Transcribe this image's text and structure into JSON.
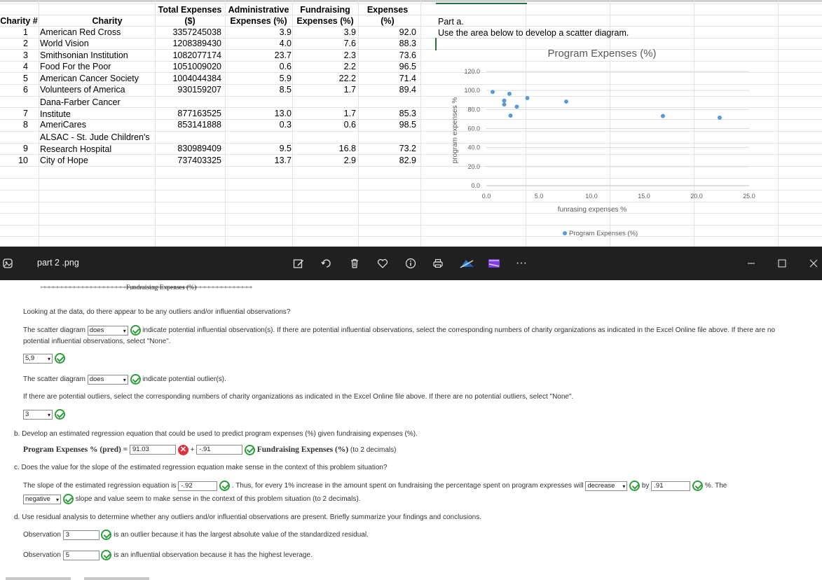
{
  "spreadsheet": {
    "headers": {
      "charity_num": "Charity #",
      "charity": "Charity",
      "total_l1": "Total Expenses",
      "total_l2": "($)",
      "admin_l1": "Administrative",
      "admin_l2": "Expenses (%)",
      "fund_l1": "Fundraising",
      "fund_l2": "Expenses (%)",
      "prog_l1": "Expenses",
      "prog_l2": "(%)"
    },
    "rows": [
      {
        "num": "1",
        "name": [
          "American Red Cross"
        ],
        "total": "3357245038",
        "admin": "3.9",
        "fund": "3.9",
        "prog": "92.0"
      },
      {
        "num": "2",
        "name": [
          "World Vision"
        ],
        "total": "1208389430",
        "admin": "4.0",
        "fund": "7.6",
        "prog": "88.3"
      },
      {
        "num": "3",
        "name": [
          "Smithsonian Institution"
        ],
        "total": "1082077174",
        "admin": "23.7",
        "fund": "2.3",
        "prog": "73.6"
      },
      {
        "num": "4",
        "name": [
          "Food For the Poor"
        ],
        "total": "1051009020",
        "admin": "0.6",
        "fund": "2.2",
        "prog": "96.5"
      },
      {
        "num": "5",
        "name": [
          "American Cancer Society"
        ],
        "total": "1004044384",
        "admin": "5.9",
        "fund": "22.2",
        "prog": "71.4"
      },
      {
        "num": "6",
        "name": [
          "Volunteers of America"
        ],
        "total": "930159207",
        "admin": "8.5",
        "fund": "1.7",
        "prog": "89.4"
      },
      {
        "num": "7",
        "name": [
          "Dana-Farber Cancer",
          "Institute"
        ],
        "total": "877163525",
        "admin": "13.0",
        "fund": "1.7",
        "prog": "85.3"
      },
      {
        "num": "8",
        "name": [
          "AmeriCares"
        ],
        "total": "853141888",
        "admin": "0.3",
        "fund": "0.6",
        "prog": "98.5"
      },
      {
        "num": "9",
        "name": [
          "ALSAC - St. Jude Children's",
          "Research Hospital"
        ],
        "total": "830989409",
        "admin": "9.5",
        "fund": "16.8",
        "prog": "73.2"
      },
      {
        "num": "10",
        "name": [
          "City of Hope"
        ],
        "total": "737403325",
        "admin": "13.7",
        "fund": "2.9",
        "prog": "82.9"
      }
    ],
    "part_a_label": "Part a.",
    "part_a_text": "Use the area below to develop a scatter diagram."
  },
  "chart_data": {
    "type": "scatter",
    "title": "Program Expenses (%)",
    "xlabel": "funrasing expenses %",
    "ylabel": "program expenses %",
    "xlim": [
      0,
      25
    ],
    "ylim": [
      0,
      120
    ],
    "x_ticks": [
      "0.0",
      "5.0",
      "10.0",
      "15.0",
      "20.0",
      "25.0"
    ],
    "y_ticks": [
      "0.0",
      "20.0",
      "40.0",
      "60.0",
      "80.0",
      "100.0",
      "120.0"
    ],
    "legend": "bottom",
    "grid": true,
    "series": [
      {
        "name": "Program Expenses (%)",
        "color": "#5b9bd5",
        "points": [
          [
            0.6,
            98.5
          ],
          [
            1.7,
            89.4
          ],
          [
            1.7,
            85.3
          ],
          [
            2.2,
            96.5
          ],
          [
            2.3,
            73.6
          ],
          [
            2.9,
            82.9
          ],
          [
            3.9,
            92.0
          ],
          [
            7.6,
            88.3
          ],
          [
            16.8,
            73.2
          ],
          [
            22.2,
            71.4
          ]
        ]
      }
    ]
  },
  "viewer": {
    "filename": "part 2 .png",
    "fragment_label": "Fundraising Expenses (%)"
  },
  "question": {
    "intro": "Looking at the data, do there appear to be any outliers and/or influential observations?",
    "infl_prefix": "The scatter diagram",
    "infl_select": "does",
    "infl_suffix": "indicate potential influential observation(s). If there are potential influential observations, select the corresponding numbers of charity organizations as indicated in the Excel Online file above. If there are no potential influential observations, select \"None\".",
    "infl_answer": "5,9",
    "out_prefix": "The scatter diagram",
    "out_select": "does",
    "out_suffix": "indicate potential outlier(s).",
    "out_instruction": "If there are potential outliers, select the corresponding numbers of charity organizations as indicated in the Excel Online file above. If there are no potential outliers, select \"None\".",
    "out_answer": "3",
    "b_text": "b. Develop an estimated regression equation that could be used to predict program expenses (%) given fundraising expenses (%).",
    "b_lhs": "Program Expenses % (pred) =",
    "b_intercept": "91.03",
    "b_plus": "+",
    "b_slope": "-.91",
    "b_rhs": "Fundraising Expenses (%)",
    "b_note": "(to 2 decimals)",
    "c_text": "c. Does the value for the slope of the estimated regression equation make sense in the context of this problem situation?",
    "c_prefix": "The slope of the estimated regression equation is",
    "c_slope": "-.92",
    "c_mid": ". Thus, for every 1% increase in the amount spent on fundraising the percentage spent on program expresses will",
    "c_dir": "decrease",
    "c_by": "by",
    "c_amount": ".91",
    "c_pct": "%. The",
    "c_sign": "negative",
    "c_end": "slope and value seem to make sense in the context of this problem situation (to 2 decimals).",
    "d_text": "d. Use residual analysis to determine whether any outliers and/or influential observations are present. Briefly summarize your findings and conclusions.",
    "obs_label": "Observation",
    "obs_outlier": "3",
    "obs_outlier_text": "is an outlier because it has the largest absolute value of the standardized residual.",
    "obs_infl": "5",
    "obs_infl_text": "is an influential observation because it has the highest leverage."
  }
}
